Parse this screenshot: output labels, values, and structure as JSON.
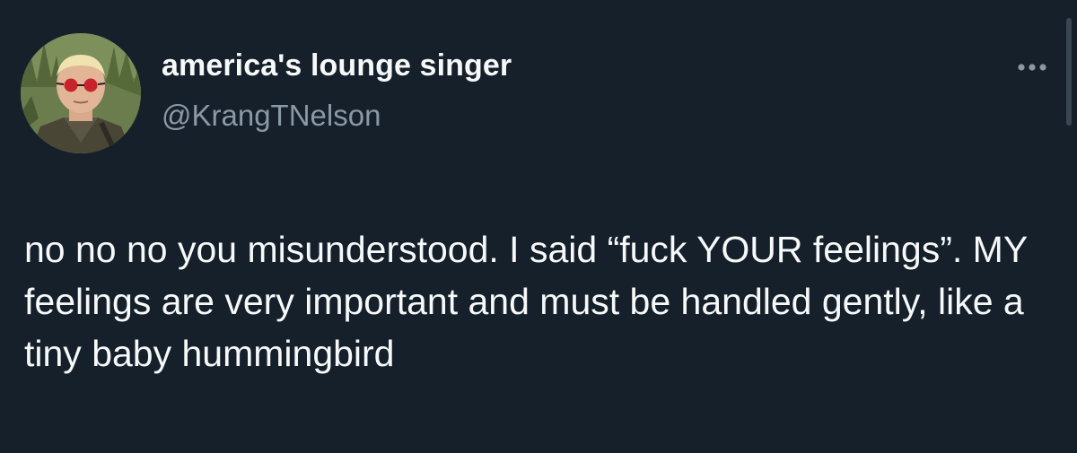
{
  "tweet": {
    "author": {
      "display_name": "america's lounge singer",
      "handle": "@KrangTNelson"
    },
    "more_icon": "more-horizontal-icon",
    "text": "no no no you misunderstood. I said “fuck YOUR feelings”. MY feelings are very important and must be handled gently, like a tiny baby hummingbird"
  },
  "colors": {
    "background": "#15202b",
    "primary_text": "#f7f9f9",
    "secondary_text": "#8b98a5"
  }
}
